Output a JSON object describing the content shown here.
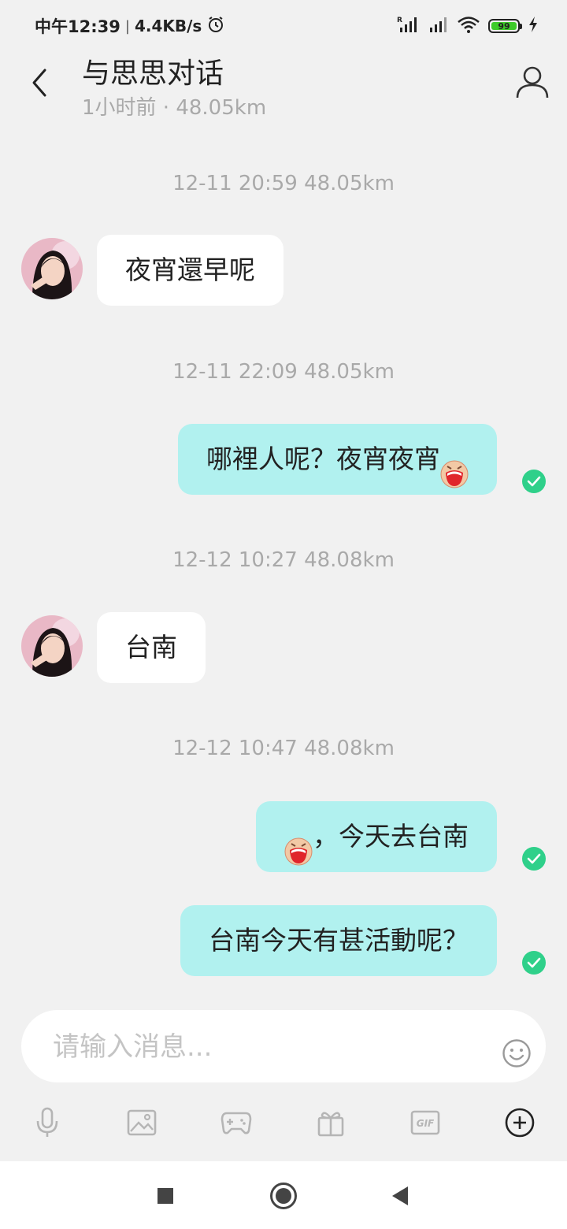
{
  "status_bar": {
    "time": "中午12:39",
    "separator": "|",
    "network_speed": "4.4KB/s",
    "battery_level": "99",
    "icons": [
      "alarm-icon",
      "signal-icon",
      "signal-icon",
      "wifi-icon",
      "battery-icon",
      "charging-icon"
    ]
  },
  "header": {
    "title": "与思思对话",
    "subtitle": "1小时前 · 48.05km",
    "back_icon": "chevron-left-icon",
    "profile_icon": "user-icon"
  },
  "messages": [
    {
      "timestamp": "12-11 20:59  48.05km",
      "direction": "incoming",
      "text": "夜宵還早呢"
    },
    {
      "timestamp": "12-11 22:09  48.05km",
      "direction": "outgoing",
      "text": "哪裡人呢？夜宵夜宵",
      "emoji_after": "laughing-emoji",
      "read": true
    },
    {
      "timestamp": "12-12 10:27  48.08km",
      "direction": "incoming",
      "text": "台南"
    },
    {
      "timestamp": "12-12 10:47  48.08km",
      "direction": "outgoing",
      "text": "，今天去台南",
      "emoji_before": "laughing-emoji",
      "read": true
    },
    {
      "direction": "outgoing",
      "text": "台南今天有甚活動呢？",
      "read": true
    }
  ],
  "composer": {
    "placeholder": "请输入消息...",
    "value": "",
    "emoji_icon": "smiley-icon"
  },
  "toolbar": {
    "items": [
      "microphone-icon",
      "image-icon",
      "game-controller-icon",
      "gift-icon",
      "gif-icon",
      "plus-circle-icon"
    ],
    "gif_label": "GIF"
  },
  "nav": [
    "square-icon",
    "circle-icon",
    "triangle-back-icon"
  ],
  "colors": {
    "background": "#f1f1f1",
    "outgoing_bubble": "#b1f1ef",
    "incoming_bubble": "#ffffff",
    "read_check": "#2fd08a"
  }
}
